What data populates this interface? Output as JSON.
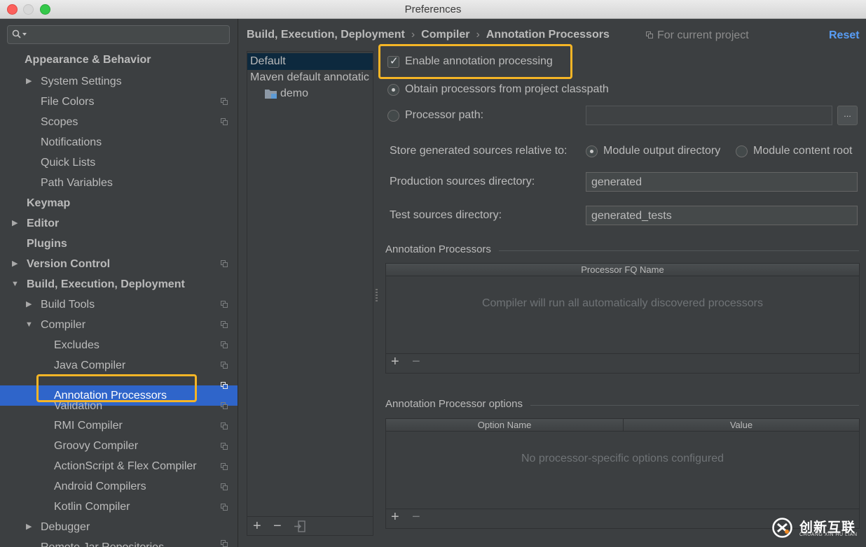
{
  "window": {
    "title": "Preferences"
  },
  "sidebar": {
    "items": [
      {
        "label": "Appearance & Behavior",
        "bold": true
      },
      {
        "label": "System Settings"
      },
      {
        "label": "File Colors"
      },
      {
        "label": "Scopes"
      },
      {
        "label": "Notifications"
      },
      {
        "label": "Quick Lists"
      },
      {
        "label": "Path Variables"
      },
      {
        "label": "Keymap",
        "bold": true
      },
      {
        "label": "Editor",
        "bold": true
      },
      {
        "label": "Plugins",
        "bold": true
      },
      {
        "label": "Version Control",
        "bold": true
      },
      {
        "label": "Build, Execution, Deployment",
        "bold": true
      },
      {
        "label": "Build Tools"
      },
      {
        "label": "Compiler"
      },
      {
        "label": "Excludes"
      },
      {
        "label": "Java Compiler"
      },
      {
        "label": "Annotation Processors",
        "selected": true
      },
      {
        "label": "Validation"
      },
      {
        "label": "RMI Compiler"
      },
      {
        "label": "Groovy Compiler"
      },
      {
        "label": "ActionScript & Flex Compiler"
      },
      {
        "label": "Android Compilers"
      },
      {
        "label": "Kotlin Compiler"
      },
      {
        "label": "Debugger"
      },
      {
        "label": "Remote Jar Repositories"
      }
    ]
  },
  "breadcrumb": {
    "part1": "Build, Execution, Deployment",
    "part2": "Compiler",
    "part3": "Annotation Processors",
    "sep": "›"
  },
  "scope": {
    "label": "For current project"
  },
  "actions": {
    "reset": "Reset"
  },
  "profiles": {
    "items": [
      "Default",
      "Maven default annotatic",
      "demo"
    ],
    "add": "+",
    "remove": "−"
  },
  "settings": {
    "enable_label": "Enable annotation processing",
    "enable_checked": true,
    "obtain_label": "Obtain processors from project classpath",
    "path_label": "Processor path:",
    "path_value": "",
    "browse_label": "...",
    "store_label": "Store generated sources relative to:",
    "store_opt1": "Module output directory",
    "store_opt2": "Module content root",
    "prod_label": "Production sources directory:",
    "prod_value": "generated",
    "test_label": "Test sources directory:",
    "test_value": "generated_tests"
  },
  "processors": {
    "title": "Annotation Processors",
    "column": "Processor FQ Name",
    "empty": "Compiler will run all automatically discovered processors",
    "add": "+",
    "remove": "−"
  },
  "options": {
    "title": "Annotation Processor options",
    "col1": "Option Name",
    "col2": "Value",
    "empty": "No processor-specific options configured",
    "add": "+",
    "remove": "−"
  },
  "watermark": {
    "cn": "创新互联",
    "en": "CHUANG XIN HU LIAN"
  },
  "colors": {
    "selection": "#2f65ca",
    "highlight": "#f5b526",
    "link": "#589df6"
  }
}
